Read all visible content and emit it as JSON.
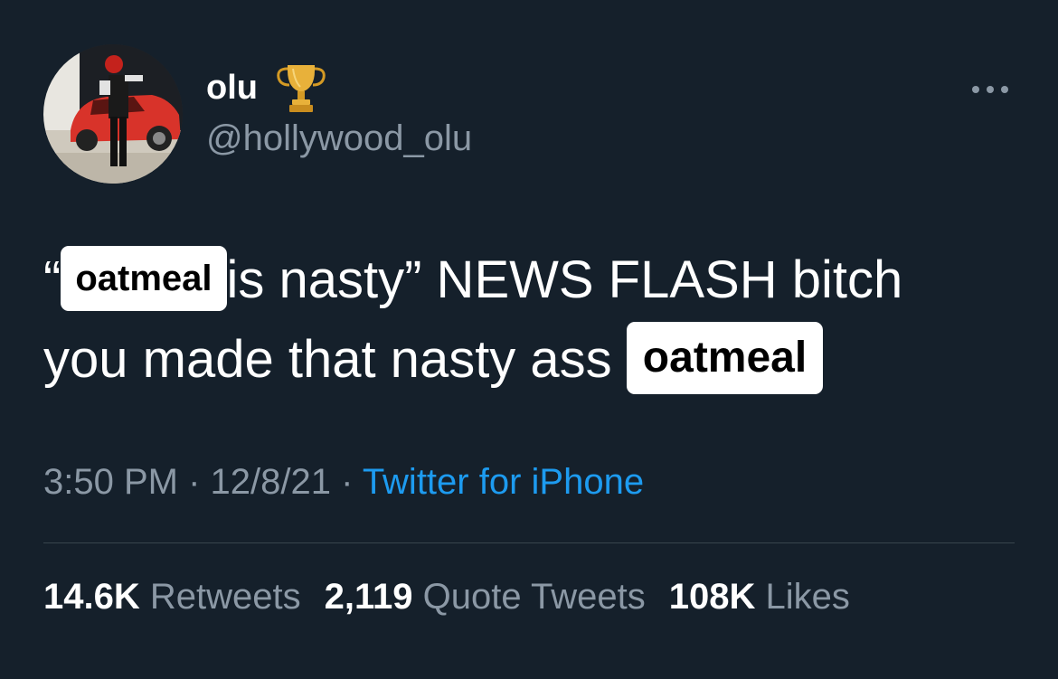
{
  "author": {
    "name": "olu",
    "name_emoji": "trophy-icon",
    "handle": "@hollywood_olu"
  },
  "tweet": {
    "open_quote": "“",
    "redacted_word_1": "oatmeal",
    "text_1": "is nasty” NEWS FLASH bitch",
    "text_2": "you made that nasty ass ",
    "redacted_word_2": "oatmeal"
  },
  "meta": {
    "time": "3:50 PM",
    "sep_1": " · ",
    "date": "12/8/21",
    "sep_2": " · ",
    "source": "Twitter for iPhone"
  },
  "stats": {
    "retweets_count": "14.6K",
    "retweets_label": "Retweets",
    "quotes_count": "2,119",
    "quotes_label": "Quote Tweets",
    "likes_count": "108K",
    "likes_label": "Likes"
  },
  "colors": {
    "background": "#15202b",
    "secondary_text": "#8b98a5",
    "link": "#1d9bf0",
    "divider": "#38444d"
  }
}
